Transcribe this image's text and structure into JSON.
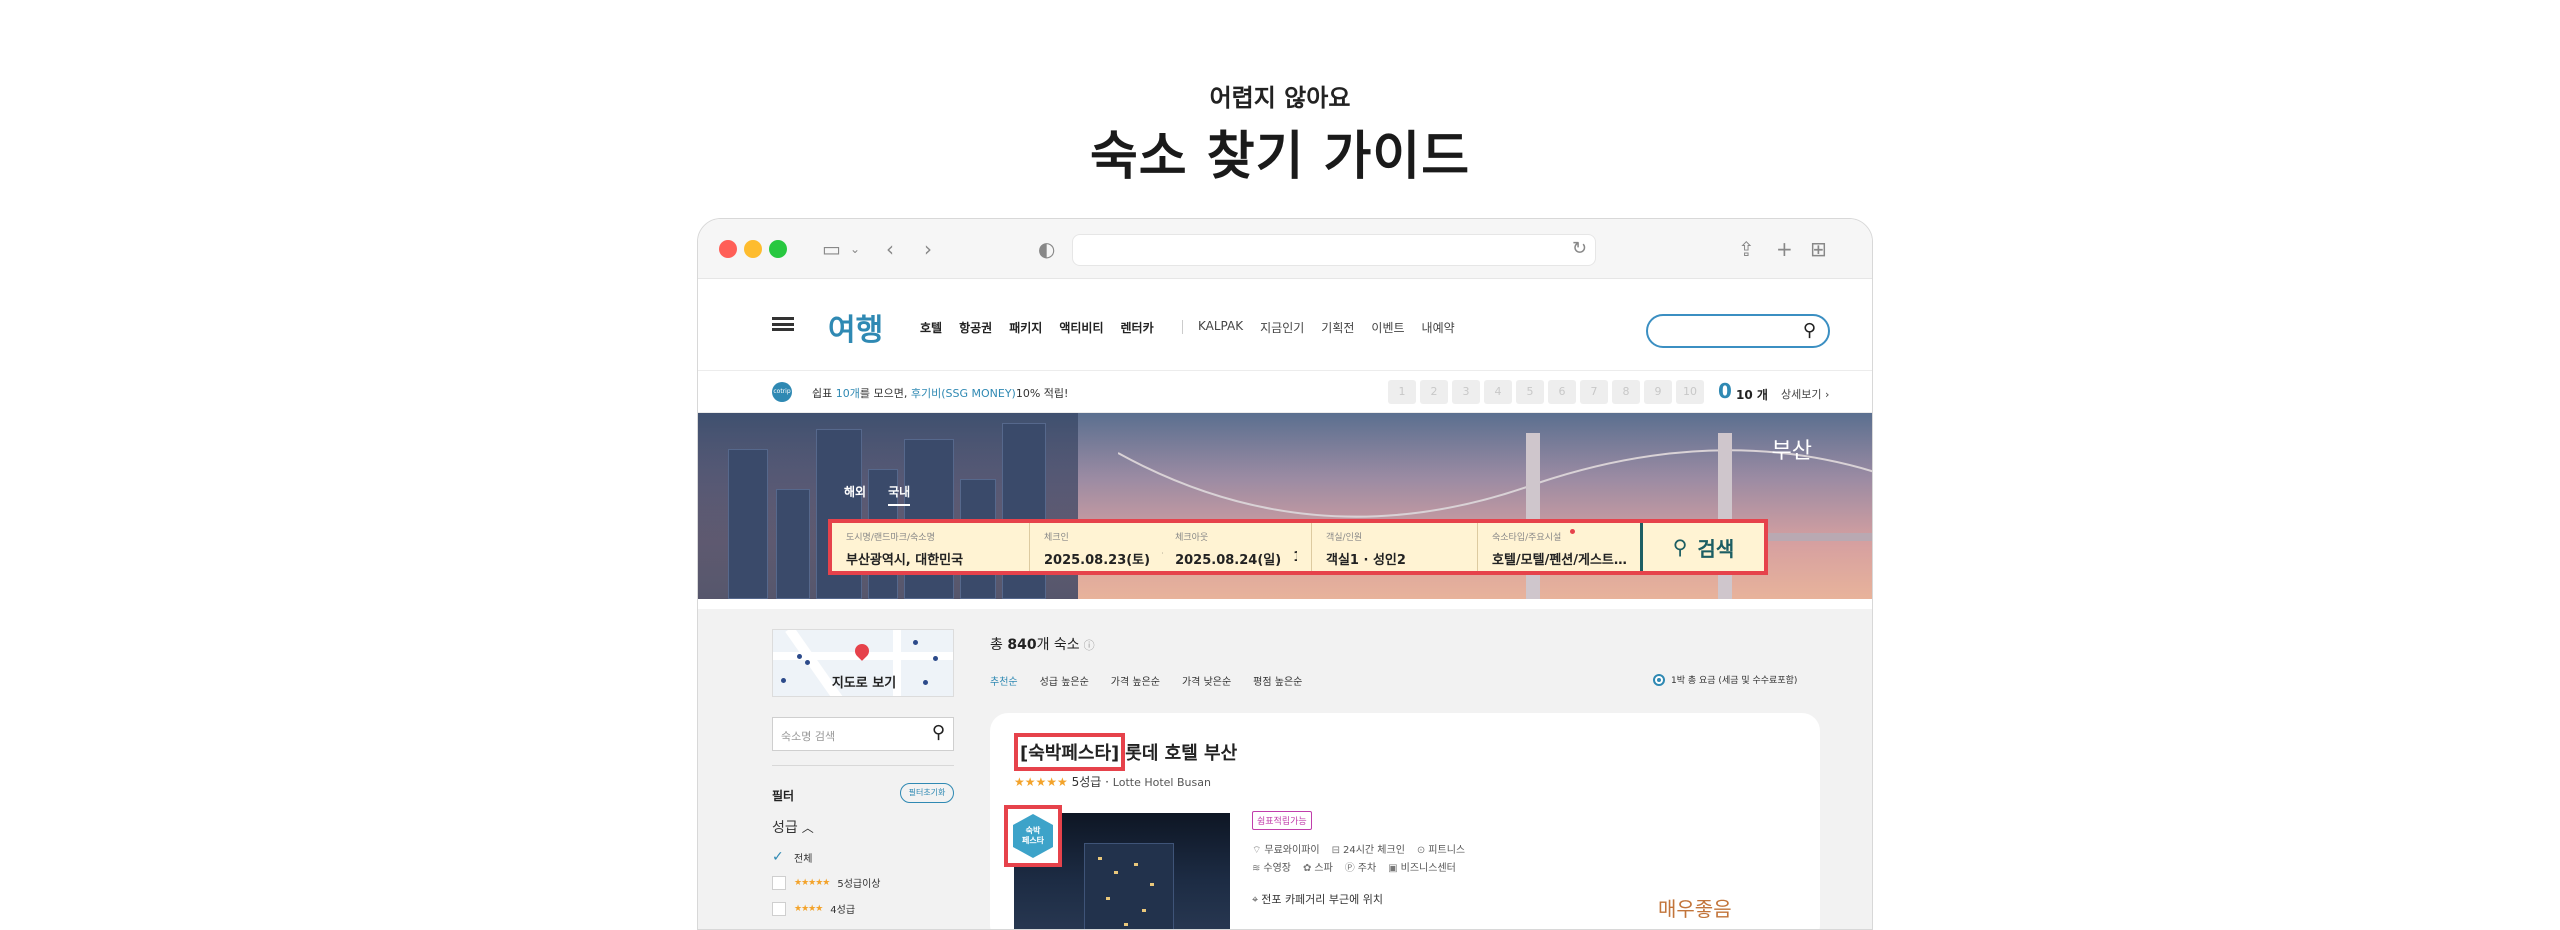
{
  "hero": {
    "subtitle": "어렵지 않아요",
    "title": "숙소 찾기 가이드"
  },
  "browser": {
    "url": "",
    "icons": [
      "sidebar-icon",
      "chevron-down-icon",
      "back-icon",
      "forward-icon",
      "shield-icon",
      "reload-icon",
      "share-icon",
      "new-tab-icon",
      "tabs-grid-icon"
    ]
  },
  "header": {
    "brand": "여행",
    "nav": [
      "호텔",
      "항공권",
      "패키지",
      "액티비티",
      "렌터카"
    ],
    "nav_secondary": [
      "KALPAK",
      "지금인기",
      "기획전",
      "이벤트",
      "내예약"
    ],
    "search_placeholder": ""
  },
  "promo": {
    "logo": "cotrip",
    "text_prefix": "쉽표 ",
    "text_count": "10개",
    "text_mid": "를 모으면, ",
    "text_highlight": "후기비(SSG MONEY)",
    "text_suffix": "10% 적립!",
    "stamps": [
      "1",
      "2",
      "3",
      "4",
      "5",
      "6",
      "7",
      "8",
      "9",
      "10"
    ],
    "count": "0",
    "unit": "10 개",
    "more": "상세보기 ›"
  },
  "banner": {
    "city": "부산",
    "tabs": [
      "해외",
      "국내"
    ],
    "active_tab": "국내"
  },
  "search_bar": {
    "destination_label": "도시명/랜드마크/숙소명",
    "destination_value": "부산광역시, 대한민국",
    "checkin_label": "체크인",
    "checkin_value": "2025.08.23(토)",
    "checkout_label": "체크아웃",
    "checkout_value": "2025.08.24(일)",
    "date_separator": "-",
    "nights": "1박",
    "guests_label": "객실/인원",
    "guests_value": "객실1 · 성인2",
    "type_label": "숙소타입/주요시설",
    "type_value": "호텔/모텔/펜션/게스트…",
    "search_button": "검색"
  },
  "sidebar": {
    "map_label": "지도로 보기",
    "name_search_placeholder": "숙소명 검색",
    "filter_title": "필터",
    "filter_reset": "필터초기화",
    "grade_title": "성급",
    "grade_options": [
      {
        "label": "전체",
        "stars": "",
        "checked": true
      },
      {
        "label": "5성급이상",
        "stars": "★★★★★",
        "checked": false
      },
      {
        "label": "4성급",
        "stars": "★★★★",
        "checked": false
      }
    ]
  },
  "results": {
    "total_prefix": "총 ",
    "total_count": "840",
    "total_suffix": "개 숙소",
    "sorts": [
      "추천순",
      "성급 높은순",
      "가격 높은순",
      "가격 낮은순",
      "평점 높은순"
    ],
    "active_sort": "추천순",
    "price_option": "1박 총 요금 (세금 및 수수료포함)"
  },
  "hotel_card": {
    "badge": "[숙박페스타]",
    "name": "롯데 호텔 부산",
    "stars": "★★★★★",
    "grade": "5성급",
    "english_name": "Lotte Hotel Busan",
    "fest_badge_line1": "숙박",
    "fest_badge_line2": "페스타",
    "tag": "쉼표적립가능",
    "amenities_row1": [
      {
        "icon": "wifi-icon",
        "glyph": "⌔",
        "label": "무료와이파이"
      },
      {
        "icon": "clock-icon",
        "glyph": "⊟",
        "label": "24시간 체크인"
      },
      {
        "icon": "fitness-icon",
        "glyph": "⊙",
        "label": "피트니스"
      }
    ],
    "amenities_row2": [
      {
        "icon": "pool-icon",
        "glyph": "≋",
        "label": "수영장"
      },
      {
        "icon": "spa-icon",
        "glyph": "✿",
        "label": "스파"
      },
      {
        "icon": "parking-icon",
        "glyph": "Ⓟ",
        "label": "주차"
      },
      {
        "icon": "business-icon",
        "glyph": "▣",
        "label": "비즈니스센터"
      }
    ],
    "location": "전포 카페거리 부근에 위치",
    "review": "매우좋음"
  },
  "colors": {
    "accent": "#2f89b3",
    "highlight_border": "#e6424b",
    "search_bg": "#fff3d3",
    "search_button_text": "#1c5e63",
    "review": "#c2743a"
  }
}
